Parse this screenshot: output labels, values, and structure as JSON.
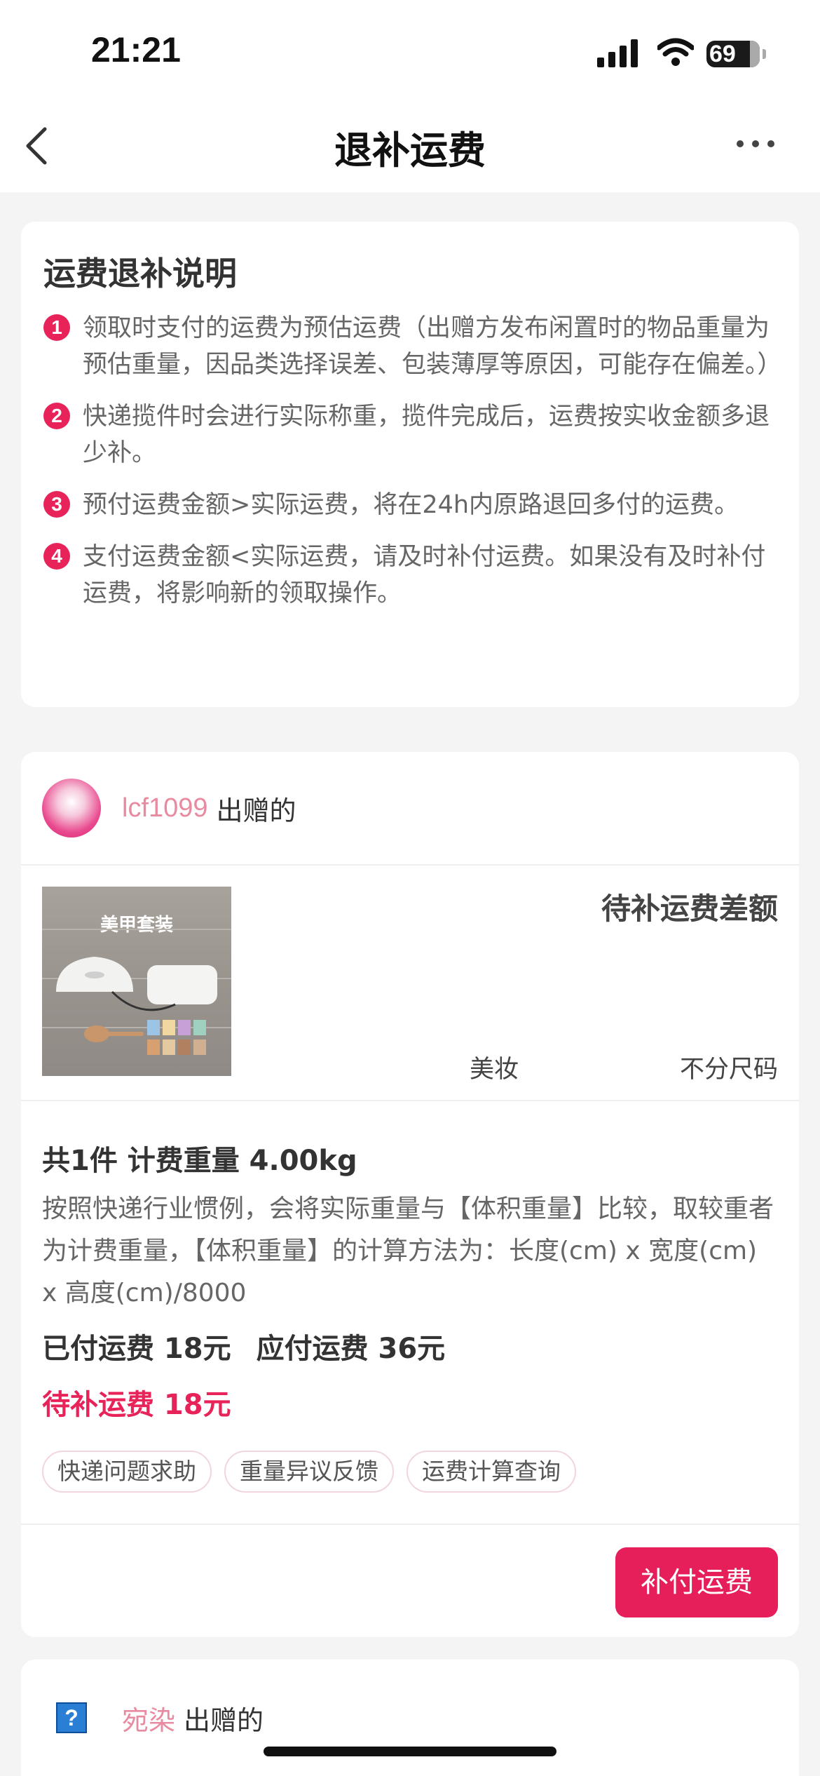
{
  "status_bar": {
    "time": "21:21",
    "battery": "69"
  },
  "nav": {
    "title": "退补运费"
  },
  "explain": {
    "title": "运费退补说明",
    "rules": [
      {
        "num": "1",
        "text": "领取时支付的运费为预估运费（出赠方发布闲置时的物品重量为预估重量，因品类选择误差、包装薄厚等原因，可能存在偏差。）"
      },
      {
        "num": "2",
        "text": "快递揽件时会进行实际称重，揽件完成后，运费按实收金额多退少补。"
      },
      {
        "num": "3",
        "text": "预付运费金额>实际运费，将在24h内原路退回多付的运费。"
      },
      {
        "num": "4",
        "text": "支付运费金额<实际运费，请及时补付运费。如果没有及时补付运费，将影响新的领取操作。"
      }
    ]
  },
  "gift1": {
    "giver_name": "lcf1099",
    "giver_suffix": "出赠的",
    "image_label": "美甲套装",
    "status": "待补运费差额",
    "category": "美妆",
    "size": "不分尺码",
    "count_weight": "共1件 计费重量 4.00kg",
    "note": "按照快递行业惯例，会将实际重量与【体积重量】比较，取较重者为计费重量，【体积重量】的计算方法为：长度(cm) x 宽度(cm) x 高度(cm)/8000",
    "paid": "已付运费 18元",
    "due": "应付运费 36元",
    "pending": "待补运费 18元",
    "tags": [
      "快递问题求助",
      "重量异议反馈",
      "运费计算查询"
    ],
    "pay_button": "补付运费"
  },
  "gift2": {
    "giver_name": "宛染",
    "giver_suffix": "出赠的",
    "avatar_glyph": "?"
  }
}
